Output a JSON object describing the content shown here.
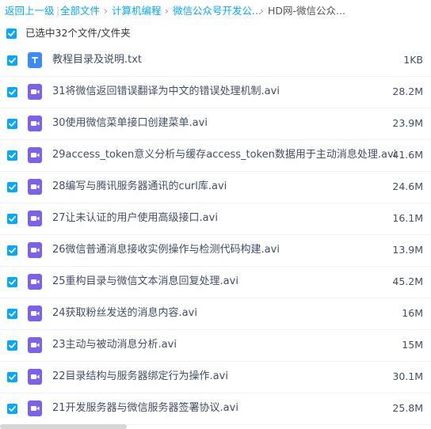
{
  "breadcrumb": {
    "back": "返回上一级",
    "all_files": "全部文件",
    "crumb1": "计算机编程",
    "crumb2": "微信公众号开发公...",
    "current": "HD网-微信公众..."
  },
  "selection": {
    "text": "已选中32个文件/文件夹"
  },
  "files": [
    {
      "name": "教程目录及说明.txt",
      "size": "1KB",
      "icon": "text-file-icon"
    },
    {
      "name": "31将微信返回错误翻译为中文的错误处理机制.avi",
      "size": "28.2M",
      "icon": "video-file-icon"
    },
    {
      "name": "30使用微信菜单接口创建菜单.avi",
      "size": "23.9M",
      "icon": "video-file-icon"
    },
    {
      "name": "29access_token意义分析与缓存access_token数据用于主动消息处理.avi",
      "size": "41.6M",
      "icon": "video-file-icon"
    },
    {
      "name": "28编写与腾讯服务器通讯的curl库.avi",
      "size": "24.6M",
      "icon": "video-file-icon"
    },
    {
      "name": "27让未认证的用户使用高级接口.avi",
      "size": "16.1M",
      "icon": "video-file-icon"
    },
    {
      "name": "26微信普通消息接收实例操作与检测代码构建.avi",
      "size": "13.9M",
      "icon": "video-file-icon"
    },
    {
      "name": "25重构目录与微信文本消息回复处理.avi",
      "size": "45.2M",
      "icon": "video-file-icon"
    },
    {
      "name": "24获取粉丝发送的消息内容.avi",
      "size": "16M",
      "icon": "video-file-icon"
    },
    {
      "name": "23主动与被动消息分析.avi",
      "size": "15M",
      "icon": "video-file-icon"
    },
    {
      "name": "22目录结构与服务器绑定行为操作.avi",
      "size": "30.1M",
      "icon": "video-file-icon"
    },
    {
      "name": "21开发服务器与微信服务器签署协议.avi",
      "size": "25.8M",
      "icon": "video-file-icon"
    }
  ],
  "colors": {
    "accent": "#06a7ff",
    "video_icon": "#7b61ee",
    "text_icon": "#3b8cf8"
  }
}
